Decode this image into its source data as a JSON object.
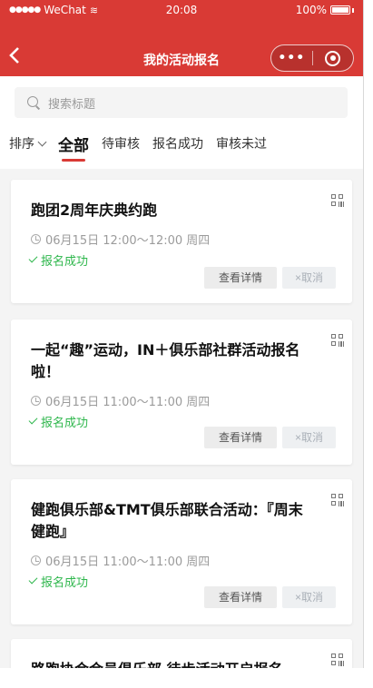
{
  "status_bar": {
    "carrier": "WeChat",
    "time": "20:08",
    "battery": "100%"
  },
  "nav": {
    "back_icon": "chevron-left-icon",
    "title": "我的活动报名",
    "more": "•••"
  },
  "search": {
    "placeholder": "搜索标题"
  },
  "filters": {
    "sort_label": "排序",
    "tabs": [
      {
        "label": "全部",
        "active": true
      },
      {
        "label": "待审核"
      },
      {
        "label": "报名成功"
      },
      {
        "label": "审核未过"
      }
    ]
  },
  "activities": [
    {
      "title": "跑团2周年庆典约跑",
      "time": "06月15日 12:00～12:00 周四",
      "status": "报名成功",
      "detail_label": "查看详情",
      "cancel_label": "×取消"
    },
    {
      "title": "一起“趣”运动，IN＋俱乐部社群活动报名啦！",
      "time": "06月15日 11:00～11:00 周四",
      "status": "报名成功",
      "detail_label": "查看详情",
      "cancel_label": "×取消"
    },
    {
      "title": "健跑俱乐部&TMT俱乐部联合活动：『周末健跑』",
      "time": "06月15日 11:00～11:00 周四",
      "status": "报名成功",
      "detail_label": "查看详情",
      "cancel_label": "×取消"
    },
    {
      "title": "路跑协会会员俱乐部 徒步活动开启报名"
    }
  ],
  "colors": {
    "brand_red": "#d93a35",
    "success_green": "#2fb74d"
  }
}
